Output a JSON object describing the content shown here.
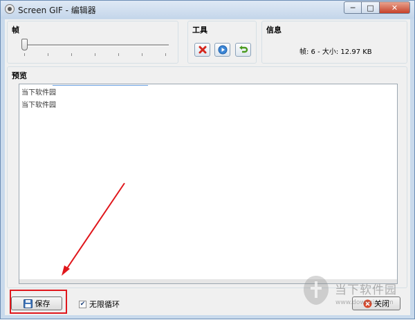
{
  "window": {
    "title": "Screen GIF - 编辑器",
    "min_label": "─",
    "max_label": "□",
    "close_label": "✕"
  },
  "frame_group": {
    "label": "帧"
  },
  "tools_group": {
    "label": "工具"
  },
  "info_group": {
    "label": "信息",
    "text": "帧: 6 - 大小: 12.97 KB"
  },
  "preview_group": {
    "label": "预览",
    "lines": [
      "当下软件园",
      "当下软件园"
    ]
  },
  "footer": {
    "save_label": "保存",
    "loop_label": "无限循环",
    "loop_checked": "✔",
    "close_label": "关闭"
  },
  "watermark": {
    "text": "当下软件园",
    "url": "www.downxia.com"
  },
  "icons": {
    "delete": "delete-icon",
    "play": "play-icon",
    "undo": "undo-icon",
    "save": "floppy-icon",
    "close": "close-icon"
  },
  "colors": {
    "highlight": "#e0161b",
    "accent": "#6b8db5"
  }
}
